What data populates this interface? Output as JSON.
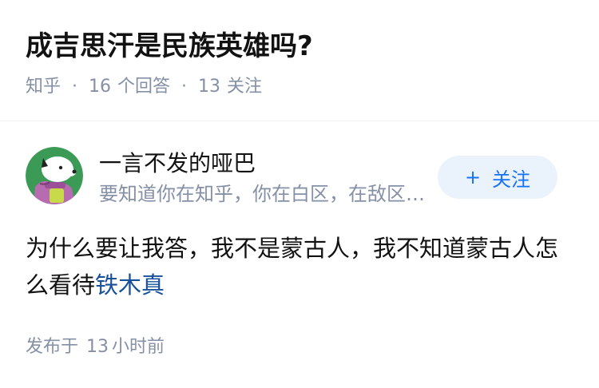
{
  "question": {
    "title": "成吉思汗是民族英雄吗?",
    "source": "知乎",
    "separator": "·",
    "answer_count": "16",
    "answer_label": "个回答",
    "follower_count": "13",
    "follower_label": "关注"
  },
  "author": {
    "name": "一言不发的哑巴",
    "bio": "要知道你在知乎，你在白区，在敌区……",
    "avatar_icon": "cartoon-dog-avatar",
    "follow_label": "关注",
    "follow_icon": "plus-icon"
  },
  "answer": {
    "text": "为什么要让我答，我不是蒙古人，我不知道蒙古人怎么看待",
    "link_text": "铁木真",
    "time_prefix": "发布于",
    "time_value": "13",
    "time_suffix": "小时前"
  },
  "colors": {
    "accent": "#1772f6",
    "follow_bg": "#eaf2fc",
    "muted": "#8590a6",
    "link": "#175199",
    "avatar_bg": "#3a9a56"
  }
}
